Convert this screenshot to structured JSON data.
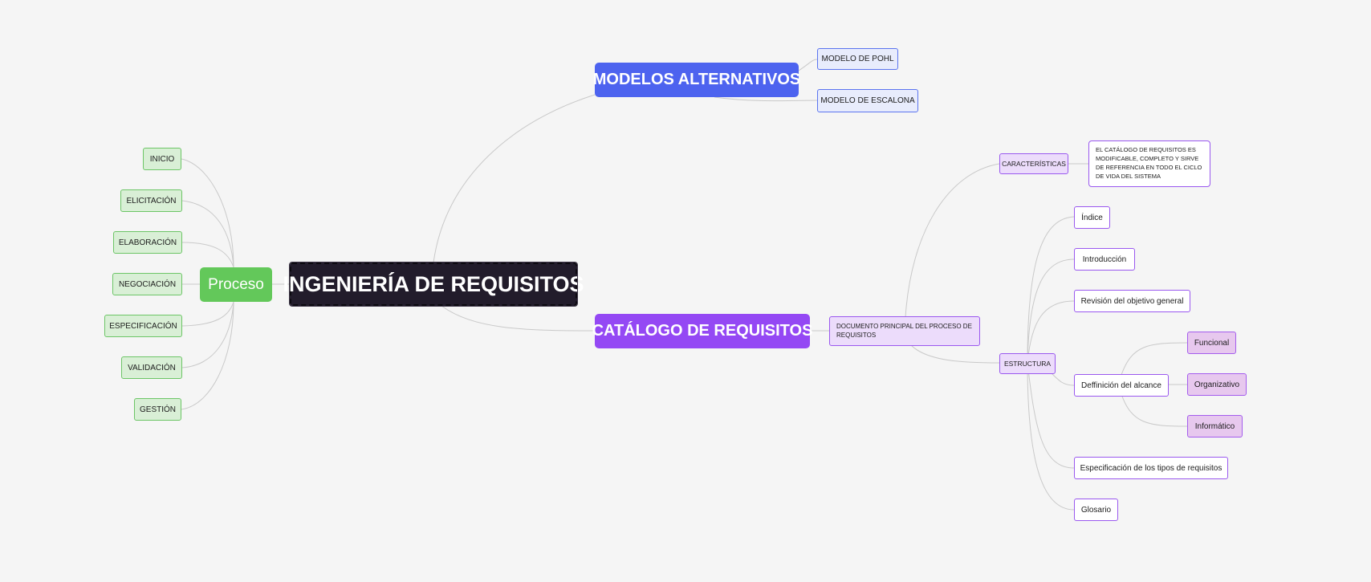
{
  "central": {
    "label": "INGENIERÍA DE REQUISITOS"
  },
  "modelos": {
    "label": "MODELOS ALTERNATIVOS",
    "children": [
      "MODELO DE POHL",
      "MODELO DE ESCALONA"
    ]
  },
  "catalogo": {
    "label": "CATÁLOGO DE REQUISITOS",
    "documento": "DOCUMENTO PRINCIPAL DEL PROCESO DE REQUISITOS",
    "caracteristicas": "CARACTERÍSTICAS",
    "caracteristicas_note": "EL CATÁLOGO DE REQUISITOS ES MODIFICABLE, COMPLETO Y SIRVE DE REFERENCIA EN TODO EL CICLO DE VIDA DEL SISTEMA",
    "estructura": "ESTRUCTURA",
    "estructura_items": [
      "Índice",
      "Introducción",
      "Revisión del objetivo general",
      "Deffinición del alcance",
      "Especificación de los tipos de requisitos",
      "Glosario"
    ],
    "alcance_items": [
      "Funcional",
      "Organizativo",
      "Informático"
    ]
  },
  "proceso": {
    "label": "Proceso",
    "children": [
      "INICIO",
      "ELICITACIÓN",
      "ELABORACIÓN",
      "NEGOCIACIÓN",
      "ESPECIFICACIÓN",
      "VALIDACIÓN",
      "GESTIÓN"
    ]
  },
  "colors": {
    "central": "#221c2b",
    "modelos": "#4d63ef",
    "catalogo": "#9448f4",
    "proceso": "#63c85a",
    "edge": "#c8c8c8"
  }
}
